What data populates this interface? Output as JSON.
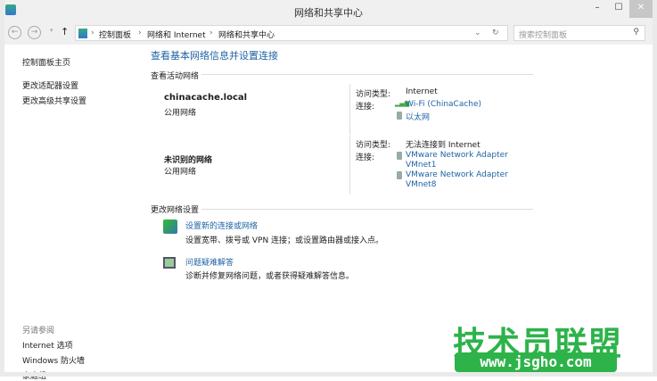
{
  "window": {
    "title": "网络和共享中心",
    "minimize": "–",
    "maximize": "☐",
    "close": "✕"
  },
  "address": {
    "back": "←",
    "forward": "→",
    "up": "↑",
    "crumbs": [
      "控制面板",
      "网络和 Internet",
      "网络和共享中心"
    ],
    "separator": "›",
    "dropdown": "⌄",
    "refresh": "↻",
    "search_placeholder": "搜索控制面板",
    "search_icon": "⚲"
  },
  "sidebar": {
    "items": [
      "控制面板主页",
      "更改适配器设置",
      "更改高级共享设置"
    ],
    "see_also_label": "另请参阅",
    "see_also": [
      "Internet 选项",
      "Windows 防火墙",
      "家庭组"
    ]
  },
  "main": {
    "heading": "查看基本网络信息并设置连接",
    "active_label": "查看活动网络",
    "networks": [
      {
        "name": "chinacache.local",
        "type": "公用网络",
        "access_label": "访问类型:",
        "access": "Internet",
        "conn_label": "连接:",
        "connections": [
          "Wi-Fi (ChinaCache)",
          "以太网"
        ]
      },
      {
        "name": "未识别的网络",
        "type": "公用网络",
        "access_label": "访问类型:",
        "access": "无法连接到 Internet",
        "conn_label": "连接:",
        "connections": [
          "VMware Network Adapter",
          "VMnet1",
          "VMware Network Adapter",
          "VMnet8"
        ]
      }
    ],
    "change_label": "更改网络设置",
    "tasks": [
      {
        "title": "设置新的连接或网络",
        "desc": "设置宽带、拨号或 VPN 连接；或设置路由器或接入点。"
      },
      {
        "title": "问题疑难解答",
        "desc": "诊断并修复网络问题，或者获得疑难解答信息。"
      }
    ]
  },
  "watermark": {
    "text": "技术员联盟",
    "url": "www.jsgho.com"
  }
}
